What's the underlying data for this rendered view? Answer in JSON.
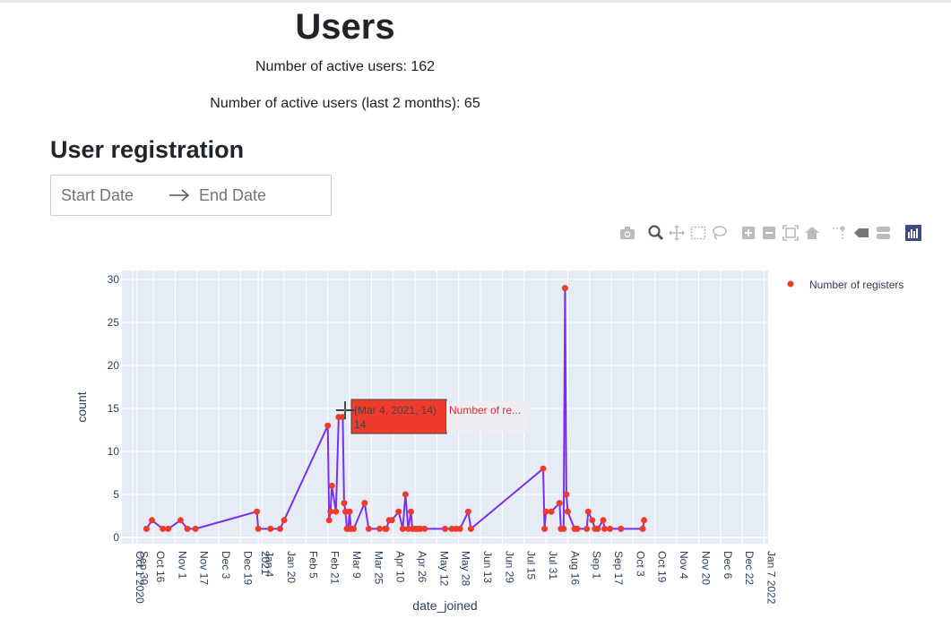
{
  "page": {
    "title": "Users",
    "active_users_text": "Number of active users: 162",
    "active_users_recent_text": "Number of active users (last 2 months): 65",
    "section_title": "User registration"
  },
  "date_range": {
    "start_placeholder": "Start Date",
    "end_placeholder": "End Date"
  },
  "modebar": {
    "buttons": [
      "camera-icon",
      "zoom-icon",
      "pan-icon",
      "box-select-icon",
      "lasso-select-icon",
      "zoom-in-icon",
      "zoom-out-icon",
      "autoscale-icon",
      "reset-axes-icon",
      "spike-lines-icon",
      "hover-closest-icon",
      "hover-compare-icon",
      "plotly-logo-icon"
    ]
  },
  "colors": {
    "line": "#7a2ff0",
    "marker": "#ef3b2c",
    "plot_bg": "#e5ecf6",
    "hover_bg": "#ef3b2c"
  },
  "tooltip": {
    "line1": "(Mar 4, 2021, 14)",
    "line2": "14",
    "series": "Number of re..."
  },
  "chart_data": {
    "type": "line",
    "xlabel": "date_joined",
    "ylabel": "count",
    "ylim": [
      0,
      30
    ],
    "y_ticks": [
      0,
      5,
      10,
      15,
      20,
      25,
      30
    ],
    "x_range": [
      "2020-09-23",
      "2022-01-10"
    ],
    "x_tick_labels": [
      {
        "date": "2020-10-01",
        "label": "Oct 1 2020"
      },
      {
        "date": "2020-10-04",
        "label": "Sep 30"
      },
      {
        "date": "2020-10-16",
        "label": "Oct 16"
      },
      {
        "date": "2020-11-01",
        "label": "Nov 1"
      },
      {
        "date": "2020-11-17",
        "label": "Nov 17"
      },
      {
        "date": "2020-12-03",
        "label": "Dec 3"
      },
      {
        "date": "2020-12-19",
        "label": "Dec 19"
      },
      {
        "date": "2021-01-01",
        "label": "2021"
      },
      {
        "date": "2021-01-04",
        "label": "Jan 4"
      },
      {
        "date": "2021-01-20",
        "label": "Jan 20"
      },
      {
        "date": "2021-02-05",
        "label": "Feb 5"
      },
      {
        "date": "2021-02-21",
        "label": "Feb 21"
      },
      {
        "date": "2021-03-09",
        "label": "Mar 9"
      },
      {
        "date": "2021-03-25",
        "label": "Mar 25"
      },
      {
        "date": "2021-04-10",
        "label": "Apr 10"
      },
      {
        "date": "2021-04-26",
        "label": "Apr 26"
      },
      {
        "date": "2021-05-12",
        "label": "May 12"
      },
      {
        "date": "2021-05-28",
        "label": "May 28"
      },
      {
        "date": "2021-06-13",
        "label": "Jun 13"
      },
      {
        "date": "2021-06-29",
        "label": "Jun 29"
      },
      {
        "date": "2021-07-15",
        "label": "Jul 15"
      },
      {
        "date": "2021-07-31",
        "label": "Jul 31"
      },
      {
        "date": "2021-08-16",
        "label": "Aug 16"
      },
      {
        "date": "2021-09-01",
        "label": "Sep 1"
      },
      {
        "date": "2021-09-17",
        "label": "Sep 17"
      },
      {
        "date": "2021-10-03",
        "label": "Oct 3"
      },
      {
        "date": "2021-10-19",
        "label": "Oct 19"
      },
      {
        "date": "2021-11-04",
        "label": "Nov 4"
      },
      {
        "date": "2021-11-20",
        "label": "Nov 20"
      },
      {
        "date": "2021-12-06",
        "label": "Dec 6"
      },
      {
        "date": "2021-12-22",
        "label": "Dec 22"
      },
      {
        "date": "2022-01-07",
        "label": "Jan 7 2022"
      }
    ],
    "series": [
      {
        "name": "Number of registers",
        "points": [
          [
            "2020-10-11",
            1
          ],
          [
            "2020-10-15",
            2
          ],
          [
            "2020-10-23",
            1
          ],
          [
            "2020-10-27",
            1
          ],
          [
            "2020-11-05",
            2
          ],
          [
            "2020-11-10",
            1
          ],
          [
            "2020-11-16",
            1
          ],
          [
            "2020-12-31",
            3
          ],
          [
            "2021-01-01",
            1
          ],
          [
            "2021-01-10",
            1
          ],
          [
            "2021-01-17",
            1
          ],
          [
            "2021-01-20",
            2
          ],
          [
            "2021-02-21",
            13
          ],
          [
            "2021-02-22",
            2
          ],
          [
            "2021-02-23",
            3
          ],
          [
            "2021-02-24",
            6
          ],
          [
            "2021-02-27",
            3
          ],
          [
            "2021-03-01",
            14
          ],
          [
            "2021-03-04",
            14
          ],
          [
            "2021-03-05",
            4
          ],
          [
            "2021-03-06",
            3
          ],
          [
            "2021-03-07",
            1
          ],
          [
            "2021-03-08",
            1
          ],
          [
            "2021-03-09",
            3
          ],
          [
            "2021-03-10",
            1
          ],
          [
            "2021-03-12",
            1
          ],
          [
            "2021-03-20",
            4
          ],
          [
            "2021-03-23",
            1
          ],
          [
            "2021-03-31",
            1
          ],
          [
            "2021-04-04",
            1
          ],
          [
            "2021-04-05",
            1
          ],
          [
            "2021-04-07",
            2
          ],
          [
            "2021-04-09",
            2
          ],
          [
            "2021-04-14",
            3
          ],
          [
            "2021-04-17",
            1
          ],
          [
            "2021-04-19",
            5
          ],
          [
            "2021-04-21",
            1
          ],
          [
            "2021-04-23",
            3
          ],
          [
            "2021-04-24",
            1
          ],
          [
            "2021-04-26",
            1
          ],
          [
            "2021-04-28",
            1
          ],
          [
            "2021-04-30",
            1
          ],
          [
            "2021-05-03",
            1
          ],
          [
            "2021-05-18",
            1
          ],
          [
            "2021-05-23",
            1
          ],
          [
            "2021-05-26",
            1
          ],
          [
            "2021-05-29",
            1
          ],
          [
            "2021-06-04",
            3
          ],
          [
            "2021-06-06",
            1
          ],
          [
            "2021-07-29",
            8
          ],
          [
            "2021-07-30",
            1
          ],
          [
            "2021-07-31",
            3
          ],
          [
            "2021-08-04",
            3
          ],
          [
            "2021-08-10",
            4
          ],
          [
            "2021-08-11",
            1
          ],
          [
            "2021-08-13",
            1
          ],
          [
            "2021-08-14",
            29
          ],
          [
            "2021-08-15",
            5
          ],
          [
            "2021-08-16",
            3
          ],
          [
            "2021-08-21",
            1
          ],
          [
            "2021-08-23",
            1
          ],
          [
            "2021-08-30",
            1
          ],
          [
            "2021-08-31",
            3
          ],
          [
            "2021-09-03",
            2
          ],
          [
            "2021-09-05",
            1
          ],
          [
            "2021-09-07",
            1
          ],
          [
            "2021-09-11",
            2
          ],
          [
            "2021-09-12",
            1
          ],
          [
            "2021-09-16",
            1
          ],
          [
            "2021-09-24",
            1
          ],
          [
            "2021-10-10",
            1
          ],
          [
            "2021-10-11",
            2
          ]
        ]
      }
    ],
    "legend_position": "top-right",
    "grid": true
  }
}
